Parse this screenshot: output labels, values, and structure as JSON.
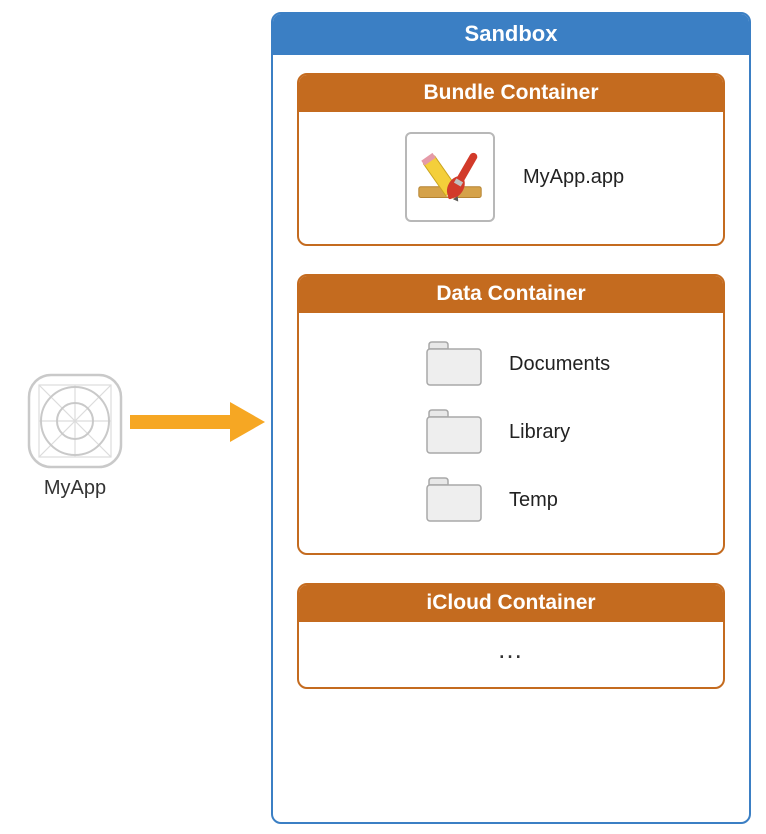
{
  "app": {
    "label": "MyApp"
  },
  "sandbox": {
    "title": "Sandbox",
    "containers": [
      {
        "title": "Bundle Container",
        "bundle_label": "MyApp.app"
      },
      {
        "title": "Data Container",
        "folders": [
          "Documents",
          "Library",
          "Temp"
        ]
      },
      {
        "title": "iCloud Container",
        "ellipsis": "…"
      }
    ]
  }
}
